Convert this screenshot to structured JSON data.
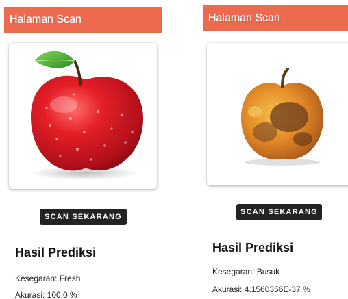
{
  "screens": [
    {
      "appbar_title": "Halaman Scan",
      "image": "fresh-red-apple",
      "scan_button": "SCAN SEKARANG",
      "result_title": "Hasil Prediksi",
      "freshness": "Kesegaran: Fresh",
      "accuracy": "Akurasi: 100.0 %"
    },
    {
      "appbar_title": "Halaman Scan",
      "image": "rotten-apple",
      "scan_button": "SCAN SEKARANG",
      "result_title": "Hasil Prediksi",
      "freshness": "Kesegaran: Busuk",
      "accuracy": "Akurasi: 4.1560356E-37 %"
    }
  ],
  "colors": {
    "appbar": "#ee6a4f",
    "button": "#232323"
  }
}
